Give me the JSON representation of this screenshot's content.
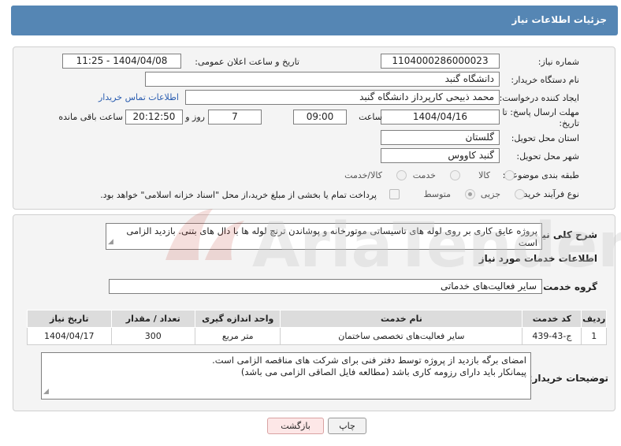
{
  "header": {
    "title": "جزئیات اطلاعات نیاز"
  },
  "form": {
    "need_number_label": "شماره نیاز:",
    "need_number": "1104000286000023",
    "announce_label": "تاریخ و ساعت اعلان عمومی:",
    "announce_value": "1404/04/08 - 11:25",
    "buyer_org_label": "نام دستگاه خریدار:",
    "buyer_org": "دانشگاه گنبد",
    "creator_label": "ایجاد کننده درخواست:",
    "creator": "محمد ذبیحی کارپرداز دانشگاه گنبد",
    "contact_link": "اطلاعات تماس خریدار",
    "deadline_label_1": "مهلت ارسال پاسخ: تا",
    "deadline_label_2": "تاریخ:",
    "deadline_date": "1404/04/16",
    "time_label": "ساعت",
    "deadline_time": "09:00",
    "days_value": "7",
    "days_label": "روز و",
    "remaining_time": "20:12:50",
    "remaining_label": "ساعت باقی مانده",
    "province_label": "استان محل تحویل:",
    "province": "گلستان",
    "city_label": "شهر محل تحویل:",
    "city": "گنبد کاووس",
    "category_label": "طبقه بندی موضوعی:",
    "category_options": [
      "کالا",
      "خدمت",
      "کالا/خدمت"
    ],
    "process_label": "نوع فرآیند خرید :",
    "process_options": [
      "جزیی",
      "متوسط"
    ],
    "payment_note": "پرداخت تمام یا بخشی از مبلغ خرید،از محل \"اسناد خزانه اسلامی\" خواهد بود."
  },
  "details": {
    "description_label": "شرح کلی نیاز:",
    "description": "پروژه عایق کاری بر روی لوله های تاسیساتی موتورخانه و پوشاندن ترنچ لوله ها با دال های بتنی. بازدید الزامی است",
    "services_title": "اطلاعات خدمات مورد نیاز",
    "service_group_label": "گروه خدمت:",
    "service_group": "سایر فعالیت‌های خدماتی",
    "table": {
      "headers": [
        "ردیف",
        "کد خدمت",
        "نام خدمت",
        "واحد اندازه گیری",
        "تعداد / مقدار",
        "تاریخ نیاز"
      ],
      "rows": [
        [
          "1",
          "ج-43-439",
          "سایر فعالیت‌های تخصصی ساختمان",
          "متر مربع",
          "300",
          "1404/04/17"
        ]
      ]
    },
    "buyer_notes_label": "توضیحات خریدار:",
    "buyer_notes_line1": "امضای برگه بازدید از پروژه توسط دفتر فنی برای شرکت های مناقصه الزامی است.",
    "buyer_notes_line2": "پیمانکار باید دارای رزومه کاری باشد (مطالعه فایل الصاقی الزامی می باشد)"
  },
  "buttons": {
    "print": "چاپ",
    "back": "بازگشت"
  },
  "watermark": {
    "text": "AriaTender.neT"
  }
}
